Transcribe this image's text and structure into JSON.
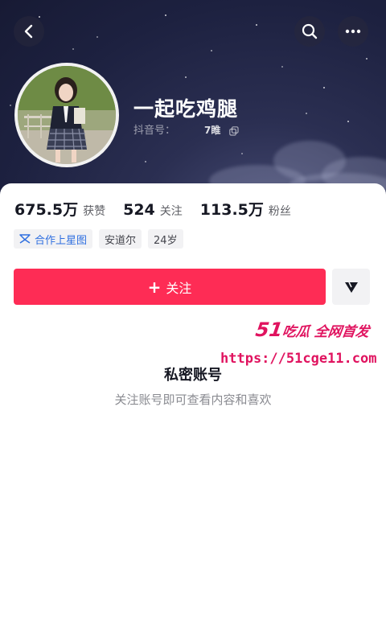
{
  "header": {
    "back_icon": "chevron-left-icon",
    "search_icon": "search-icon",
    "more_icon": "more-horizontal-icon"
  },
  "profile": {
    "nickname": "一起吃鸡腿",
    "douyin_id_label": "抖音号：",
    "douyin_id_value": "7睢",
    "copy_icon": "copy-icon"
  },
  "stats": [
    {
      "value": "675.5万",
      "label": "获赞"
    },
    {
      "value": "524",
      "label": "关注"
    },
    {
      "value": "113.5万",
      "label": "粉丝"
    }
  ],
  "tags": [
    {
      "label": "合作上星图",
      "icon": "star-map-icon"
    },
    {
      "label": "安道尔"
    },
    {
      "label": "24岁"
    }
  ],
  "actions": {
    "follow_plus": "+",
    "follow_label": "关注",
    "dm_icon": "send-message-icon"
  },
  "private": {
    "title": "私密账号",
    "subtitle": "关注账号即可查看内容和喜欢"
  },
  "watermark": {
    "brand_num": "51",
    "brand_text": "吃瓜 全网首发",
    "url": "https://51cge11.com"
  },
  "colors": {
    "accent": "#fe2c55",
    "watermark": "#e0135f",
    "header_bg": "#1d2140"
  }
}
